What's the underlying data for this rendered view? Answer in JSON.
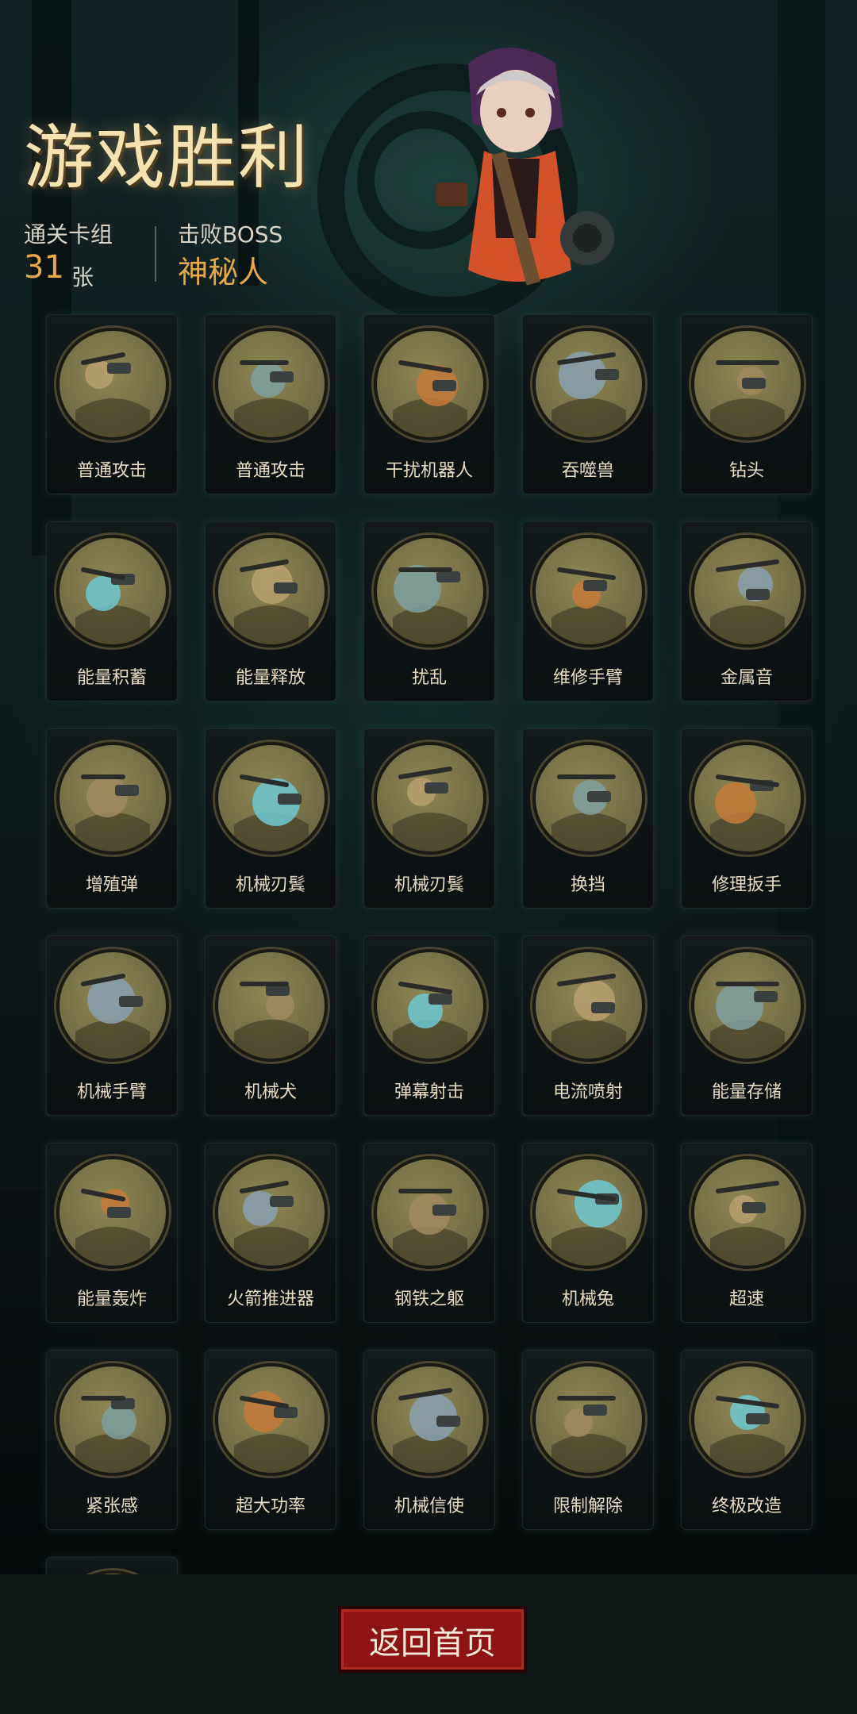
{
  "header": {
    "title": "游戏胜利",
    "cleared_deck_label": "通关卡组",
    "cleared_deck_count": "31",
    "cleared_deck_unit": "张",
    "defeated_boss_label": "击败BOSS",
    "defeated_boss_name": "神秘人"
  },
  "cards": [
    {
      "name": "普通攻击",
      "icon": "wrench-claw-icon"
    },
    {
      "name": "普通攻击",
      "icon": "claw-icon"
    },
    {
      "name": "干扰机器人",
      "icon": "robot-icon"
    },
    {
      "name": "吞噬兽",
      "icon": "beast-icon"
    },
    {
      "name": "钻头",
      "icon": "drill-icon"
    },
    {
      "name": "能量积蓄",
      "icon": "energy-icon"
    },
    {
      "name": "能量释放",
      "icon": "lightning-icon"
    },
    {
      "name": "扰乱",
      "icon": "disrupt-icon"
    },
    {
      "name": "维修手臂",
      "icon": "arm-icon"
    },
    {
      "name": "金属音",
      "icon": "horn-icon"
    },
    {
      "name": "增殖弹",
      "icon": "bomb-icon"
    },
    {
      "name": "机械刃鬂",
      "icon": "blade-icon"
    },
    {
      "name": "机械刃鬂",
      "icon": "blade-icon"
    },
    {
      "name": "换挡",
      "icon": "gear-shift-icon"
    },
    {
      "name": "修理扳手",
      "icon": "wrench-icon"
    },
    {
      "name": "机械手臂",
      "icon": "mech-arm-icon"
    },
    {
      "name": "机械犬",
      "icon": "mech-dog-icon"
    },
    {
      "name": "弹幕射击",
      "icon": "barrage-icon"
    },
    {
      "name": "电流喷射",
      "icon": "current-icon"
    },
    {
      "name": "能量存储",
      "icon": "battery-icon"
    },
    {
      "name": "能量轰炸",
      "icon": "fireball-icon"
    },
    {
      "name": "火箭推进器",
      "icon": "rocket-icon"
    },
    {
      "name": "钢铁之躯",
      "icon": "steel-body-icon"
    },
    {
      "name": "机械兔",
      "icon": "rabbit-icon"
    },
    {
      "name": "超速",
      "icon": "speed-icon"
    },
    {
      "name": "紧张感",
      "icon": "dynamite-icon"
    },
    {
      "name": "超大功率",
      "icon": "engine-icon"
    },
    {
      "name": "机械信使",
      "icon": "bird-icon"
    },
    {
      "name": "限制解除",
      "icon": "unlock-icon"
    },
    {
      "name": "终极改造",
      "icon": "mech-suit-icon"
    },
    {
      "name": "",
      "icon": "card-partial-icon"
    }
  ],
  "footer": {
    "home_button": "返回首页"
  },
  "colors": {
    "accent": "#e6a948",
    "title": "#f4e2b0",
    "button": "#8d1412"
  }
}
